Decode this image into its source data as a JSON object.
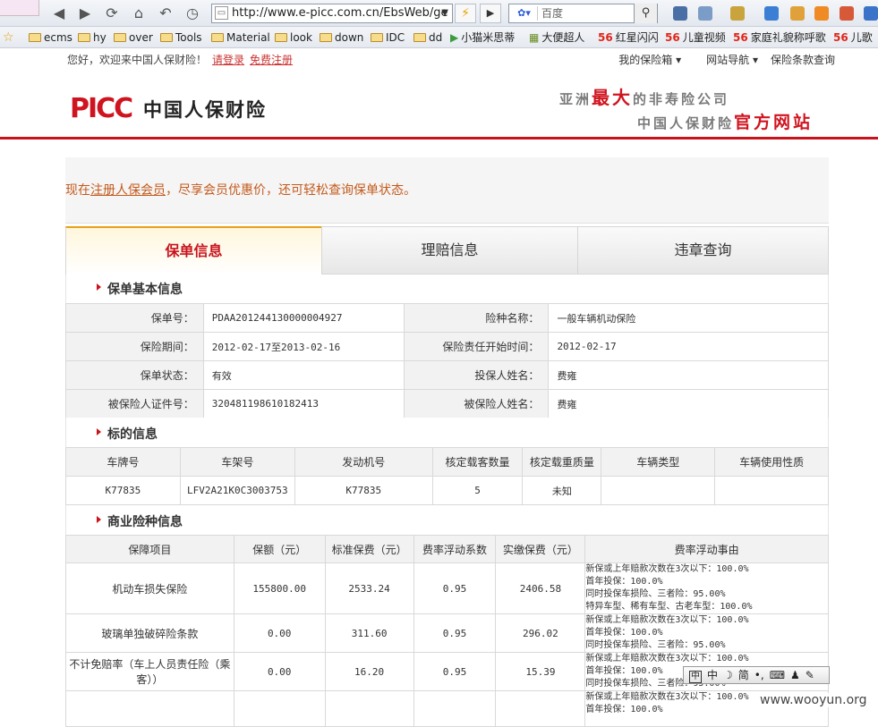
{
  "browser": {
    "url": "http://www.e-picc.com.cn/EbsWeb/ge",
    "search_engine": "百度",
    "bookmarks": [
      "ecms",
      "hy",
      "over",
      "Tools",
      "Material",
      "look",
      "down",
      "IDC",
      "dd",
      "小猫米思蒂",
      "大便超人",
      "红星闪闪",
      "儿童视频",
      "家庭礼貌称呼歌",
      "儿歌"
    ]
  },
  "topbar": {
    "welcome": "您好，欢迎来中国人保财险！",
    "login": "请登录",
    "register": "免费注册",
    "my_box": "我的保险箱",
    "site_nav": "网站导航",
    "clause": "保险条款查询"
  },
  "header": {
    "logo": "PICC",
    "company": "中国人保财险",
    "slogan1_a": "亚洲",
    "slogan1_b": "最大",
    "slogan1_c": "的非寿险公司",
    "slogan2_a": "中国人保财险",
    "slogan2_b": "官方网站"
  },
  "notice": {
    "pre": "现在",
    "link": "注册人保会员",
    "post": "，尽享会员优惠价，还可轻松查询保单状态。"
  },
  "tabs": [
    "保单信息",
    "理赔信息",
    "违章查询"
  ],
  "sections": {
    "basic": "保单基本信息",
    "target": "标的信息",
    "commercial": "商业险种信息"
  },
  "basic": [
    [
      "保单号：",
      "PDAA201244130000004927",
      "险种名称：",
      "一般车辆机动保险"
    ],
    [
      "保险期间：",
      "2012-02-17至2013-02-16",
      "保险责任开始时间：",
      "2012-02-17"
    ],
    [
      "保单状态：",
      "有效",
      "投保人姓名：",
      "费雍"
    ],
    [
      "被保险人证件号：",
      "320481198610182413",
      "被保险人姓名：",
      "费雍"
    ]
  ],
  "target": {
    "headers": [
      "车牌号",
      "车架号",
      "发动机号",
      "核定载客数量",
      "核定载重质量",
      "车辆类型",
      "车辆使用性质"
    ],
    "row": [
      "K77835",
      "LFV2A21K0C3003753",
      "K77835",
      "5",
      "未知",
      "",
      ""
    ]
  },
  "commercial": {
    "headers": [
      "保障项目",
      "保额（元）",
      "标准保费（元）",
      "费率浮动系数",
      "实缴保费（元）",
      "费率浮动事由"
    ],
    "rows": [
      {
        "name": "机动车损失保险",
        "amount": "155800.00",
        "std": "2533.24",
        "factor": "0.95",
        "paid": "2406.58",
        "reasons": [
          "新保或上年赔款次数在3次以下：100.0%",
          "首年投保：100.0%",
          "同时投保车损险、三者险：95.00%",
          "特异车型、稀有车型、古老车型：100.0%"
        ]
      },
      {
        "name": "玻璃单独破碎险条款",
        "amount": "0.00",
        "std": "311.60",
        "factor": "0.95",
        "paid": "296.02",
        "reasons": [
          "新保或上年赔款次数在3次以下：100.0%",
          "首年投保：100.0%",
          "同时投保车损险、三者险：95.00%"
        ]
      },
      {
        "name": "不计免赔率（车上人员责任险（乘客））",
        "amount": "0.00",
        "std": "16.20",
        "factor": "0.95",
        "paid": "15.39",
        "reasons": [
          "新保或上年赔款次数在3次以下：100.0%",
          "首年投保：100.0%",
          "同时投保车损险、三者险：95.00%"
        ]
      },
      {
        "name": "",
        "amount": "",
        "std": "",
        "factor": "",
        "paid": "",
        "reasons": [
          "新保或上年赔款次数在3次以下：100.0%",
          "首年投保：100.0%"
        ]
      }
    ]
  },
  "ime": [
    "中",
    "简"
  ],
  "watermark": "www.wooyun.org"
}
